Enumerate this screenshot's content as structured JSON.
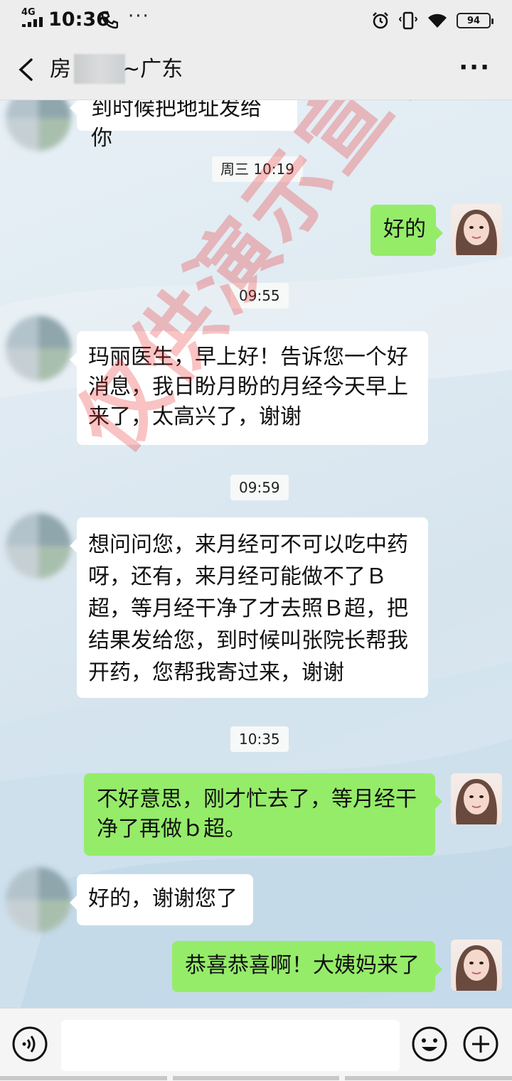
{
  "status_bar": {
    "network": "4G",
    "time": "10:36",
    "more": "···",
    "battery": "94"
  },
  "header": {
    "title_prefix": "房",
    "title_suffix": "~广东",
    "more": "···"
  },
  "messages": [
    {
      "side": "left",
      "text": "到时候把地址发给你"
    },
    {
      "type": "time",
      "text": "周三 10:19"
    },
    {
      "side": "right",
      "text": "好的"
    },
    {
      "type": "time",
      "text": "09:55"
    },
    {
      "side": "left",
      "text": "玛丽医生，早上好！告诉您一个好消息，我日盼月盼的月经今天早上来了，太高兴了，谢谢"
    },
    {
      "type": "time",
      "text": "09:59"
    },
    {
      "side": "left",
      "text": "想问问您，来月经可不可以吃中药呀，还有，来月经可能做不了Ｂ超，等月经干净了才去照Ｂ超，把结果发给您，到时候叫张院长帮我开药，您帮我寄过来，谢谢"
    },
    {
      "type": "time",
      "text": "10:35"
    },
    {
      "side": "right",
      "text": "不好意思，刚才忙去了，等月经干净了再做ｂ超。"
    },
    {
      "side": "left",
      "text": "好的，谢谢您了"
    },
    {
      "side": "right",
      "text": "恭喜恭喜啊！大姨妈来了"
    }
  ],
  "watermark": "仅供演示宣传用",
  "input": {
    "value": "",
    "placeholder": ""
  },
  "icons": {
    "back": "chevron-left-icon",
    "voice": "voice-icon",
    "emoji": "emoji-icon",
    "plus": "plus-icon"
  }
}
